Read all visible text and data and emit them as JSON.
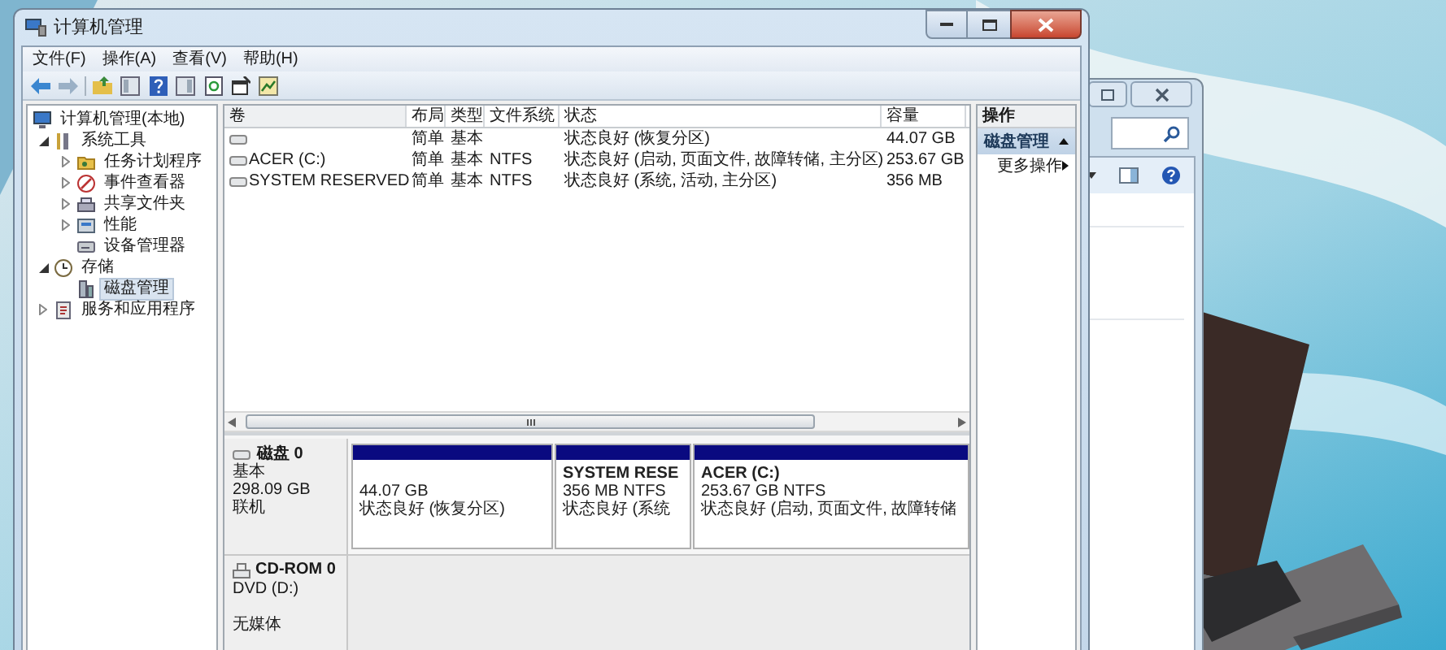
{
  "window": {
    "title": "计算机管理",
    "menu": [
      "文件(F)",
      "操作(A)",
      "查看(V)",
      "帮助(H)"
    ]
  },
  "tree": {
    "items": [
      {
        "label": "计算机管理(本地)",
        "selected": false,
        "children": [
          {
            "label": "系统工具",
            "expanded": true,
            "selected": false,
            "children": [
              {
                "label": "任务计划程序",
                "expanded": false,
                "selected": false
              },
              {
                "label": "事件查看器",
                "expanded": false,
                "selected": false
              },
              {
                "label": "共享文件夹",
                "expanded": false,
                "selected": false
              },
              {
                "label": "性能",
                "expanded": false,
                "selected": false
              },
              {
                "label": "设备管理器",
                "selected": false
              }
            ]
          },
          {
            "label": "存储",
            "expanded": true,
            "selected": false,
            "children": [
              {
                "label": "磁盘管理",
                "selected": true
              }
            ]
          },
          {
            "label": "服务和应用程序",
            "expanded": false,
            "selected": false
          }
        ]
      }
    ]
  },
  "table": {
    "columns": [
      "卷",
      "布局",
      "类型",
      "文件系统",
      "状态",
      "容量"
    ],
    "rows": [
      {
        "layout": "简单",
        "type": "基本",
        "status": "状态良好 (恢复分区)",
        "capacity": "44.07 GB"
      },
      {
        "volume": "ACER (C:)",
        "layout": "简单",
        "type": "基本",
        "filesystem": "NTFS",
        "status": "状态良好 (启动, 页面文件, 故障转储, 主分区)",
        "capacity": "253.67 GB"
      },
      {
        "volume": "SYSTEM RESERVED",
        "layout": "简单",
        "type": "基本",
        "filesystem": "NTFS",
        "status": "状态良好 (系统, 活动, 主分区)",
        "capacity": "356 MB"
      }
    ]
  },
  "disks": [
    {
      "kind": "disk",
      "name": "磁盘 0",
      "type": "基本",
      "size": "298.09 GB",
      "status": "联机",
      "partitions": [
        {
          "size": "44.07 GB",
          "status": "状态良好 (恢复分区)"
        },
        {
          "name": "SYSTEM RESE",
          "size": "356 MB NTFS",
          "status": "状态良好 (系统"
        },
        {
          "name": "ACER  (C:)",
          "size": "253.67 GB NTFS",
          "status": "状态良好 (启动, 页面文件, 故障转储"
        }
      ]
    },
    {
      "kind": "cdrom",
      "name": "CD-ROM 0",
      "drive": "DVD (D:)",
      "status": "无媒体"
    }
  ],
  "actions": {
    "title": "操作",
    "sections": [
      {
        "label": "磁盘管理",
        "expanded": true,
        "items": [
          "更多操作"
        ]
      }
    ]
  }
}
